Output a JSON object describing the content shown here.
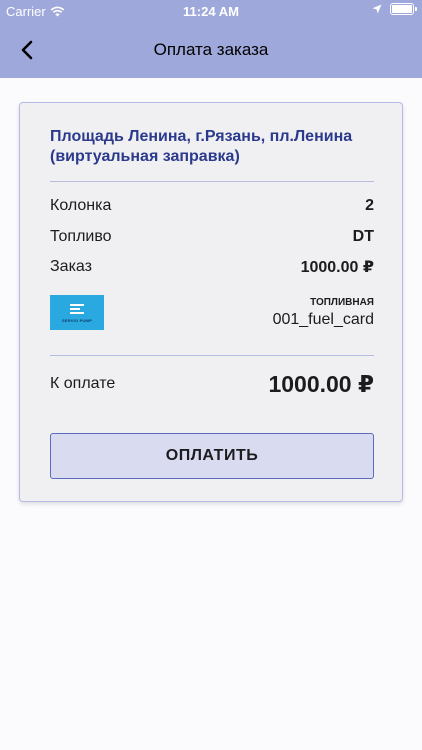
{
  "status_bar": {
    "carrier": "Carrier",
    "time": "11:24 AM"
  },
  "nav": {
    "title": "Оплата заказа"
  },
  "order": {
    "station": "Площадь Ленина, г.Рязань, пл.Ленина (виртуальная заправка)",
    "pump_label": "Колонка",
    "pump_value": "2",
    "fuel_label": "Топливо",
    "fuel_value": "DT",
    "order_label": "Заказ",
    "order_value": "1000.00 ₽"
  },
  "payment_card": {
    "logo_text": "SERVIO PUMP",
    "type": "ТОПЛИВНАЯ",
    "number": "001_fuel_card",
    "logo_color": "#29a9e0"
  },
  "total": {
    "label": "К оплате",
    "value": "1000.00 ₽"
  },
  "pay_button": {
    "label": "ОПЛАТИТЬ"
  },
  "colors": {
    "header": "#9fa8da",
    "accent": "#2b3a8c",
    "button_border": "#5c6bc0"
  }
}
